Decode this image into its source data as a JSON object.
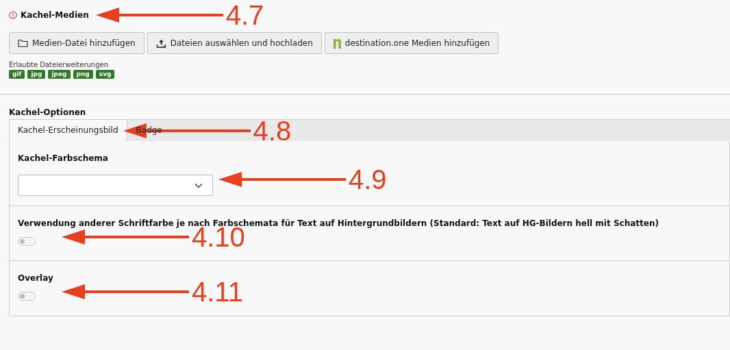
{
  "media": {
    "title": "Kachel-Medien",
    "required": true,
    "annotation": "4.7",
    "buttons": [
      {
        "kind": "folder",
        "label": "Medien-Datei hinzufügen"
      },
      {
        "kind": "upload",
        "label": "Dateien auswählen und hochladen"
      },
      {
        "kind": "logo",
        "label": "destination.one Medien hinzufügen"
      }
    ],
    "extensions_label": "Erlaubte Dateierweiterungen",
    "extensions": [
      "gif",
      "jpg",
      "jpeg",
      "png",
      "svg"
    ]
  },
  "options": {
    "title": "Kachel-Optionen",
    "tabs": [
      {
        "label": "Kachel-Erscheinungsbild",
        "selected": true,
        "annotation": "4.8"
      },
      {
        "label": "Badge",
        "selected": false
      }
    ],
    "fields": [
      {
        "kind": "select",
        "label": "Kachel-Farbschema",
        "annotation": "4.9"
      },
      {
        "kind": "toggle",
        "label": "Verwendung anderer Schriftfarbe je nach Farbschemata für Text auf Hintergrundbildern (Standard: Text auf HG-Bildern hell mit Schatten)",
        "on": false,
        "annotation": "4.10"
      },
      {
        "kind": "toggle",
        "label": "Overlay",
        "on": false,
        "annotation": "4.11"
      }
    ]
  }
}
